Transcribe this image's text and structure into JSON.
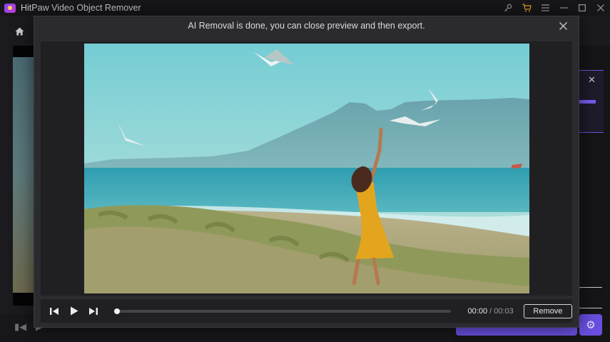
{
  "window": {
    "title": "HitPaw Video Object Remover",
    "icons": [
      "key-icon",
      "cart-icon",
      "menu-icon",
      "minimize-icon",
      "maximize-icon",
      "close-icon"
    ]
  },
  "modal": {
    "message": "AI Removal is done, you can close preview and then export.",
    "close_icon": "close-icon"
  },
  "player": {
    "current_time": "00:00",
    "separator": "/",
    "duration": "00:03",
    "progress": 0.0,
    "remove_label": "Remove",
    "icons": [
      "prev-frame-icon",
      "play-icon",
      "next-frame-icon"
    ]
  },
  "colors": {
    "accent": "#6a4fe0",
    "cart": "#f0a020"
  }
}
